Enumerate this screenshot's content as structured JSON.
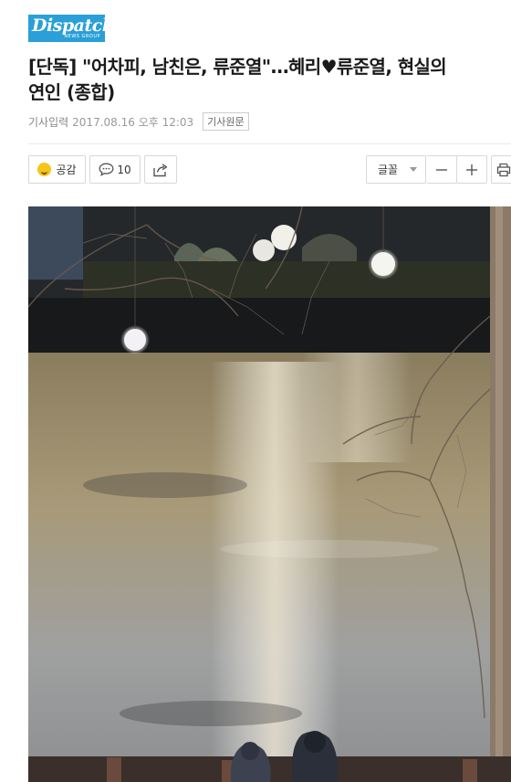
{
  "logo": {
    "brand": "Dispatch",
    "sub": "NEWS GROUP"
  },
  "article": {
    "title_line1": "[단독] \"어차피, 남친은, 류준열\"…혜리♥류준열, 현실의",
    "title_line2": "연인 (종합)",
    "meta_label": "기사입력",
    "date": "2017.08.16 오후 12:03",
    "original_link": "기사원문"
  },
  "toolbar": {
    "like_label": "공감",
    "comment_count": "10",
    "font_label": "글꼴"
  },
  "icons": [
    "smile-emoji-icon",
    "comment-bubble-icon",
    "share-icon",
    "dropdown-caret-icon",
    "minus-icon",
    "plus-icon",
    "print-icon"
  ],
  "colors": {
    "logo_bg": "#2a9fd8",
    "like_emoji": "#f5c518"
  }
}
